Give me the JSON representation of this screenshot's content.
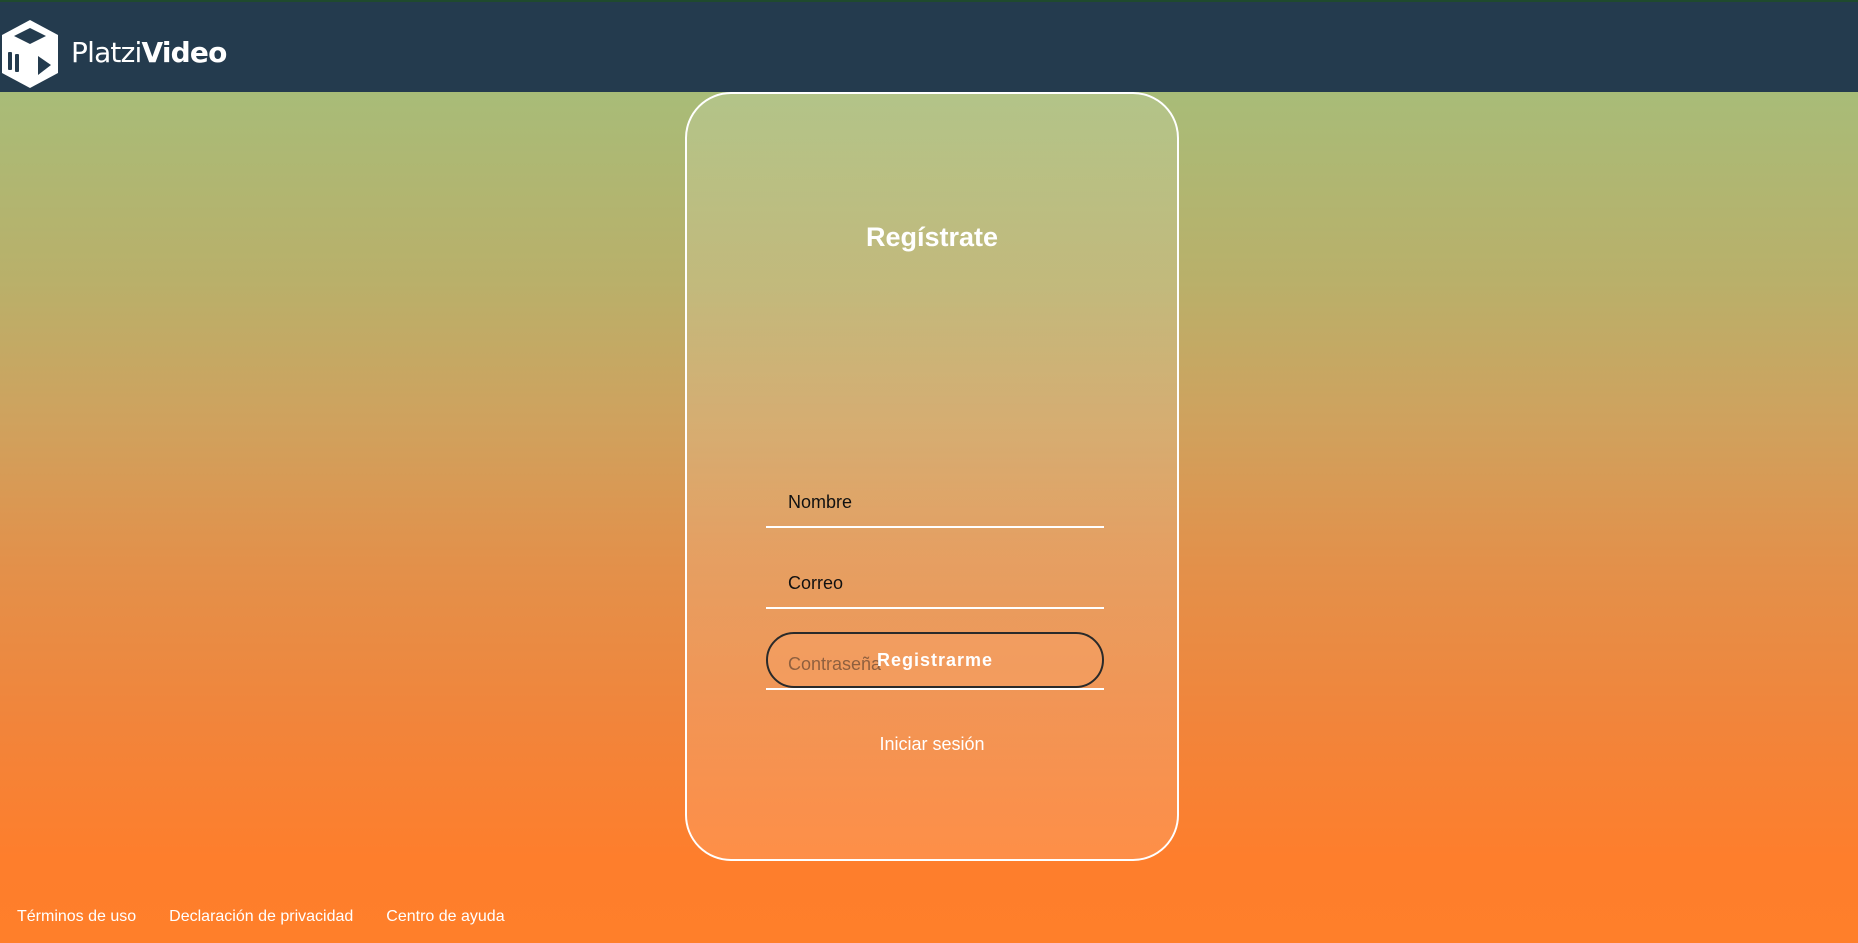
{
  "header": {
    "brand_part1": "Platzi",
    "brand_part2": "Video",
    "logo_icon": "cube-play-icon"
  },
  "register_form": {
    "title": "Regístrate",
    "fields": [
      {
        "placeholder": "Nombre",
        "value": ""
      },
      {
        "placeholder": "Correo",
        "value": ""
      },
      {
        "placeholder": "Contraseña",
        "value": ""
      }
    ],
    "submit_label": "Registrarme",
    "login_link": "Iniciar sesión"
  },
  "footer": {
    "links": [
      "Términos de uso",
      "Declaración de privacidad",
      "Centro de ayuda"
    ]
  },
  "colors": {
    "header_bg": "#243b4e",
    "gradient_top": "#a3c07f",
    "gradient_bottom": "#ff7f2a",
    "text": "#ffffff"
  }
}
